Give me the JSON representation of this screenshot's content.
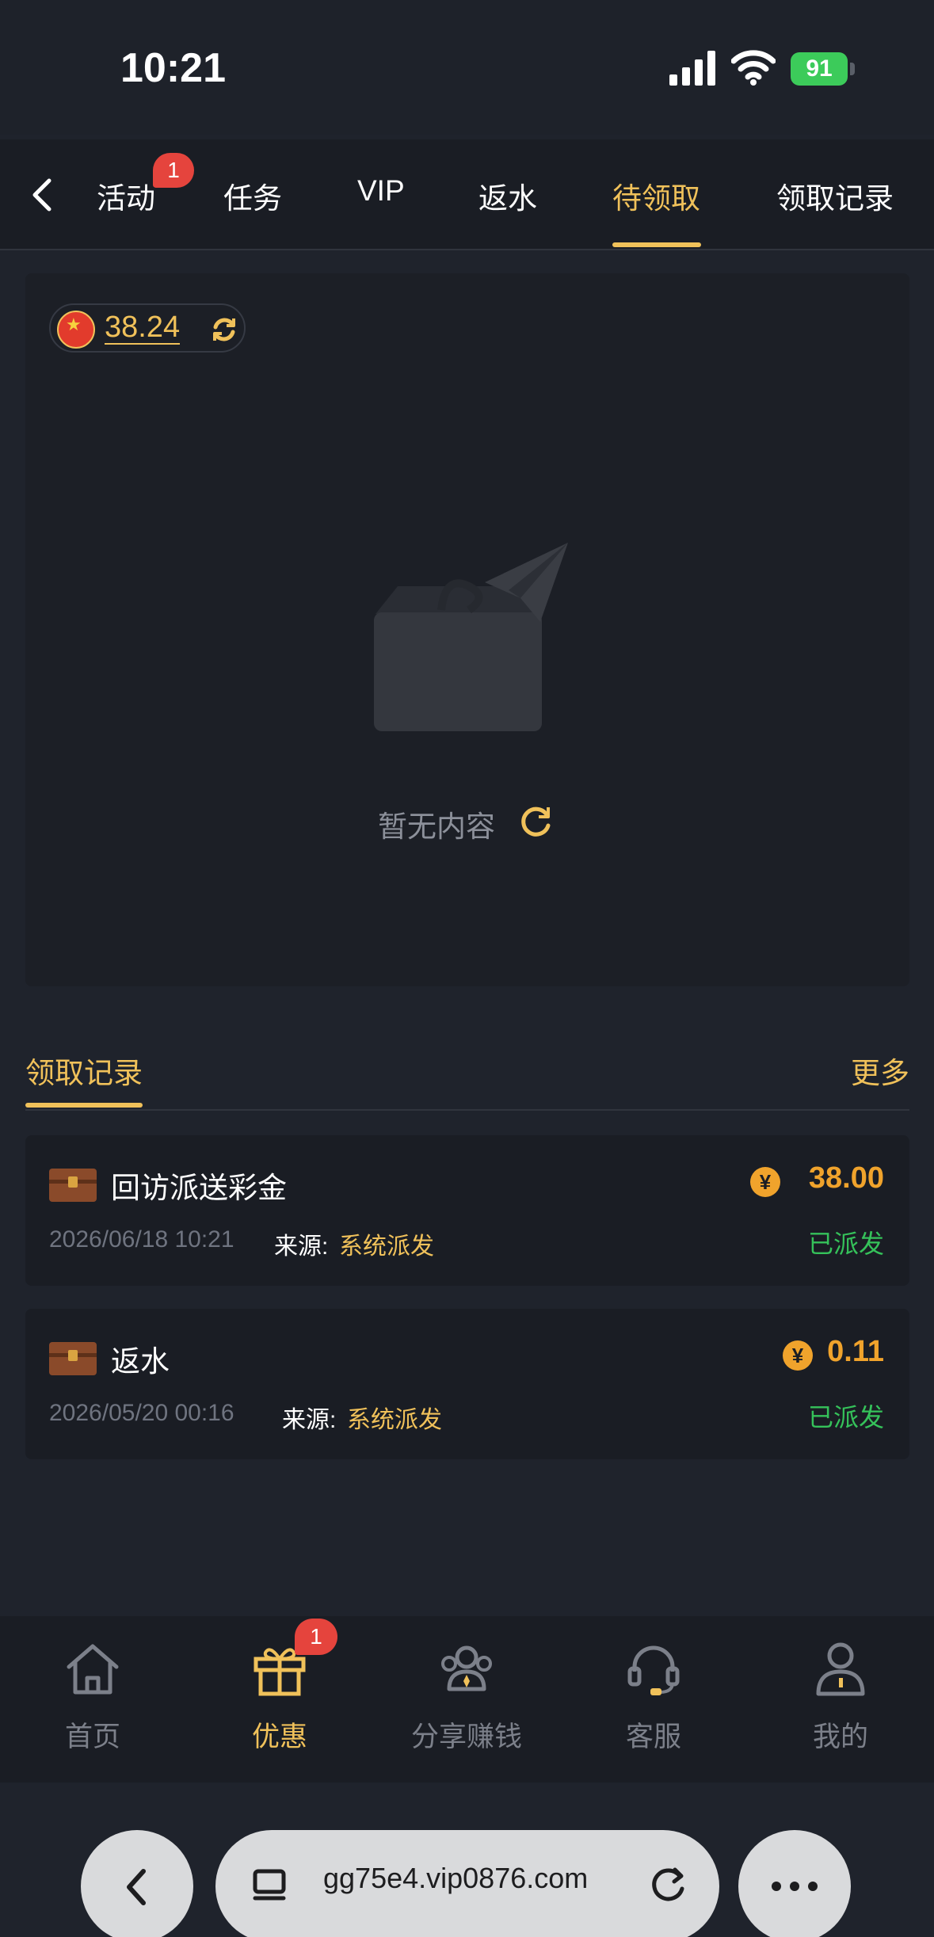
{
  "status_bar": {
    "time": "10:21",
    "battery": "91"
  },
  "tabs": {
    "items": [
      {
        "label": "活动"
      },
      {
        "label": "任务"
      },
      {
        "label": "VIP"
      },
      {
        "label": "返水"
      },
      {
        "label": "待领取"
      },
      {
        "label": "领取记录"
      }
    ],
    "active": "待领取",
    "activity_badge": "1"
  },
  "balance": {
    "value": "38.24"
  },
  "empty": {
    "text": "暂无内容"
  },
  "records": {
    "title": "领取记录",
    "more": "更多",
    "items": [
      {
        "name": "回访派送彩金",
        "date": "2026/06/18 10:21",
        "source_label": "来源:",
        "source": "系统派发",
        "currency": "¥",
        "amount": "38.00",
        "status": "已派发"
      },
      {
        "name": "返水",
        "date": "2026/05/20 00:16",
        "source_label": "来源:",
        "source": "系统派发",
        "currency": "¥",
        "amount": "0.11",
        "status": "已派发"
      }
    ]
  },
  "bottom_nav": {
    "items": [
      {
        "label": "首页",
        "icon": "home-icon"
      },
      {
        "label": "优惠",
        "icon": "gift-icon"
      },
      {
        "label": "分享赚钱",
        "icon": "share-people-icon"
      },
      {
        "label": "客服",
        "icon": "headset-icon"
      },
      {
        "label": "我的",
        "icon": "user-icon"
      }
    ],
    "active": "优惠",
    "promo_badge": "1"
  },
  "browser": {
    "url": "gg75e4.vip0876.com"
  },
  "colors": {
    "accent": "#f0c15a",
    "amount": "#f0a32c",
    "success": "#35c25a",
    "badge": "#e5443d",
    "background": "#1f232c"
  }
}
